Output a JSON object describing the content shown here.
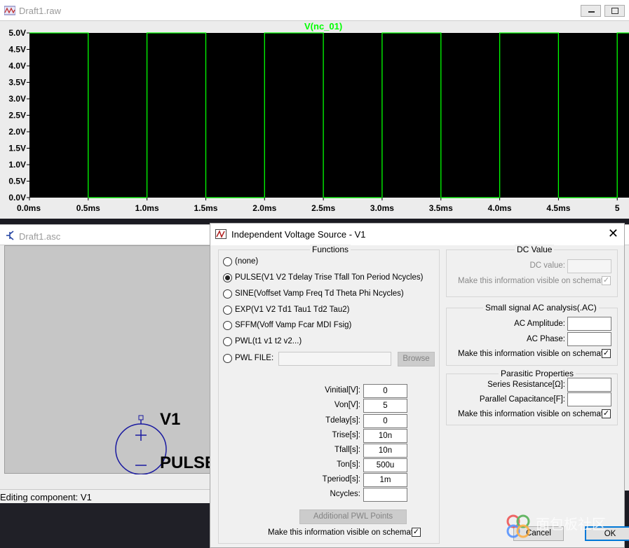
{
  "waveform_window": {
    "title": "Draft1.raw",
    "trace_label": "V(nc_01)",
    "trace_color": "#00ff00",
    "y_ticks": [
      "5.0V",
      "4.5V",
      "4.0V",
      "3.5V",
      "3.0V",
      "2.5V",
      "2.0V",
      "1.5V",
      "1.0V",
      "0.5V",
      "0.0V"
    ],
    "x_ticks": [
      "0.0ms",
      "0.5ms",
      "1.0ms",
      "1.5ms",
      "2.0ms",
      "2.5ms",
      "3.0ms",
      "3.5ms",
      "4.0ms",
      "4.5ms",
      "5"
    ]
  },
  "chart_data": {
    "type": "line",
    "series": [
      {
        "name": "V(nc_01)",
        "description_values": "pulse 0V to 5V, period 1ms, on 500us"
      }
    ],
    "x_range_ms": [
      0,
      5.1
    ],
    "ylim": [
      0,
      5.0
    ],
    "pulse": {
      "v_low": 0,
      "v_high": 5,
      "period_ms": 1.0,
      "on_ms": 0.5
    },
    "grid": false
  },
  "schematic_window": {
    "title": "Draft1.asc",
    "component_name": "V1",
    "component_value": "PULSE"
  },
  "status_bar": {
    "text": "Editing component: V1"
  },
  "dialog": {
    "title": "Independent Voltage Source - V1",
    "functions_label": "Functions",
    "functions": [
      {
        "label": "(none)",
        "selected": false
      },
      {
        "label": "PULSE(V1 V2 Tdelay Trise Tfall Ton Period Ncycles)",
        "selected": true
      },
      {
        "label": "SINE(Voffset Vamp Freq Td Theta Phi Ncycles)",
        "selected": false
      },
      {
        "label": "EXP(V1 V2 Td1 Tau1 Td2 Tau2)",
        "selected": false
      },
      {
        "label": "SFFM(Voff Vamp Fcar MDI Fsig)",
        "selected": false
      },
      {
        "label": "PWL(t1 v1 t2 v2...)",
        "selected": false
      },
      {
        "label": "PWL FILE:",
        "selected": false
      }
    ],
    "browse_label": "Browse",
    "params": [
      {
        "label": "Vinitial[V]:",
        "value": "0"
      },
      {
        "label": "Von[V]:",
        "value": "5"
      },
      {
        "label": "Tdelay[s]:",
        "value": "0"
      },
      {
        "label": "Trise[s]:",
        "value": "10n"
      },
      {
        "label": "Tfall[s]:",
        "value": "10n"
      },
      {
        "label": "Ton[s]:",
        "value": "500u"
      },
      {
        "label": "Tperiod[s]:",
        "value": "1m"
      },
      {
        "label": "Ncycles:",
        "value": ""
      }
    ],
    "additional_pwl_label": "Additional PWL Points",
    "make_visible_label": "Make this information visible on schematic:",
    "dc_value": {
      "group_label": "DC Value",
      "field_label": "DC value:",
      "visible_label": "Make this information visible on schematic:"
    },
    "ac": {
      "group_label": "Small signal AC analysis(.AC)",
      "amplitude_label": "AC Amplitude:",
      "phase_label": "AC Phase:",
      "visible_label": "Make this information visible on schematic:"
    },
    "parasitic": {
      "group_label": "Parasitic Properties",
      "series_label": "Series Resistance[Ω]:",
      "parallel_label": "Parallel Capacitance[F]:",
      "visible_label": "Make this information visible on schematic:"
    },
    "cancel_label": "Cancel",
    "ok_label": "OK"
  },
  "watermark": {
    "text": "面包板社区"
  }
}
